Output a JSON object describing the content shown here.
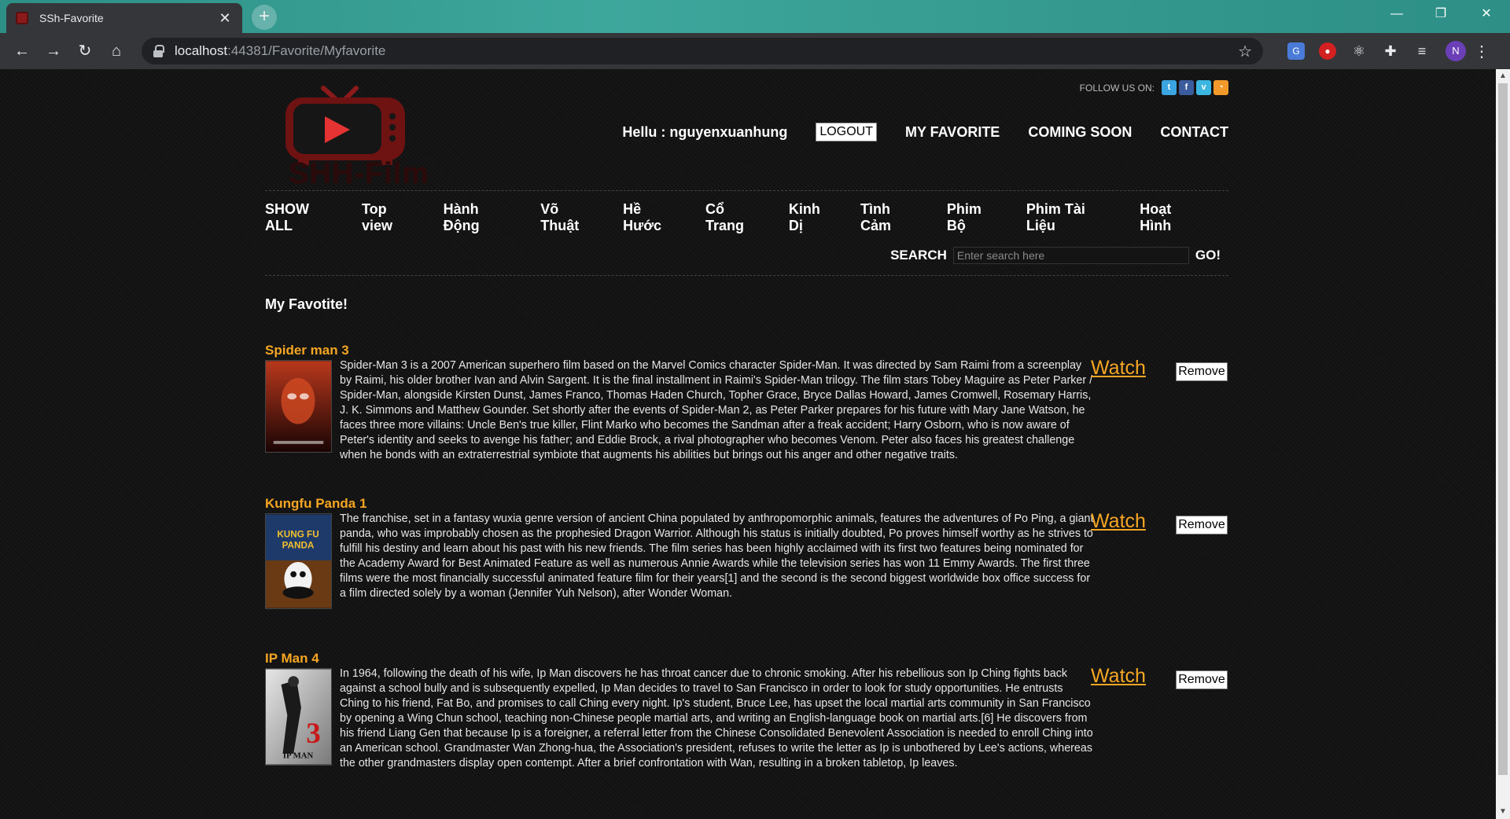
{
  "browser": {
    "tab_title": "SSh-Favorite",
    "url_host": "localhost",
    "url_rest": ":44381/Favorite/Myfavorite",
    "profile_initial": "N"
  },
  "header": {
    "logo_text": "SHH-Film",
    "follow_label": "FOLLOW US ON:",
    "social": [
      "t",
      "f",
      "v",
      "rss"
    ],
    "hello": "Hellu : nguyenxuanhung",
    "logout_label": "LOGOUT",
    "links": [
      "MY FAVORITE",
      "COMING SOON",
      "CONTACT"
    ]
  },
  "categories": [
    "SHOW ALL",
    "Top view",
    "Hành Động",
    "Võ Thuật",
    "Hề Hước",
    "Cổ Trang",
    "Kinh Dị",
    "Tình Cảm",
    "Phim Bộ",
    "Phim Tài Liệu",
    "Hoạt Hình"
  ],
  "search": {
    "label": "SEARCH",
    "placeholder": "Enter search here",
    "go_label": "GO!"
  },
  "favorites": {
    "heading": "My Favotite!",
    "watch_label": "Watch",
    "remove_label": "Remove",
    "items": [
      {
        "title": "Spider man 3",
        "description": "Spider-Man 3 is a 2007 American superhero film based on the Marvel Comics character Spider-Man. It was directed by Sam Raimi from a screenplay by Raimi, his older brother Ivan and Alvin Sargent. It is the final installment in Raimi's Spider-Man trilogy. The film stars Tobey Maguire as Peter Parker / Spider-Man, alongside Kirsten Dunst, James Franco, Thomas Haden Church, Topher Grace, Bryce Dallas Howard, James Cromwell, Rosemary Harris, J. K. Simmons and Matthew Gounder. Set shortly after the events of Spider-Man 2, as Peter Parker prepares for his future with Mary Jane Watson, he faces three more villains: Uncle Ben's true killer, Flint Marko who becomes the Sandman after a freak accident; Harry Osborn, who is now aware of Peter's identity and seeks to avenge his father; and Eddie Brock, a rival photographer who becomes Venom. Peter also faces his greatest challenge when he bonds with an extraterrestrial symbiote that augments his abilities but brings out his anger and other negative traits."
      },
      {
        "title": "Kungfu Panda 1",
        "description": "The franchise, set in a fantasy wuxia genre version of ancient China populated by anthropomorphic animals, features the adventures of Po Ping, a giant panda, who was improbably chosen as the prophesied Dragon Warrior. Although his status is initially doubted, Po proves himself worthy as he strives to fulfill his destiny and learn about his past with his new friends. The film series has been highly acclaimed with its first two features being nominated for the Academy Award for Best Animated Feature as well as numerous Annie Awards while the television series has won 11 Emmy Awards. The first three films were the most financially successful animated feature film for their years[1] and the second is the second biggest worldwide box office success for a film directed solely by a woman (Jennifer Yuh Nelson), after Wonder Woman."
      },
      {
        "title": "IP Man 4",
        "description": "In 1964, following the death of his wife, Ip Man discovers he has throat cancer due to chronic smoking. After his rebellious son Ip Ching fights back against a school bully and is subsequently expelled, Ip Man decides to travel to San Francisco in order to look for study opportunities. He entrusts Ching to his friend, Fat Bo, and promises to call Ching every night. Ip's student, Bruce Lee, has upset the local martial arts community in San Francisco by opening a Wing Chun school, teaching non-Chinese people martial arts, and writing an English-language book on martial arts.[6] He discovers from his friend Liang Gen that because Ip is a foreigner, a referral letter from the Chinese Consolidated Benevolent Association is needed to enroll Ching into an American school. Grandmaster Wan Zhong-hua, the Association's president, refuses to write the letter as Ip is unbothered by Lee's actions, whereas the other grandmasters display open contempt. After a brief confrontation with Wan, resulting in a broken tabletop, Ip leaves."
      }
    ]
  },
  "colors": {
    "accent": "#f5a623",
    "logo_red": "#8b1a1a",
    "chrome_teal": "#3ea79c"
  }
}
